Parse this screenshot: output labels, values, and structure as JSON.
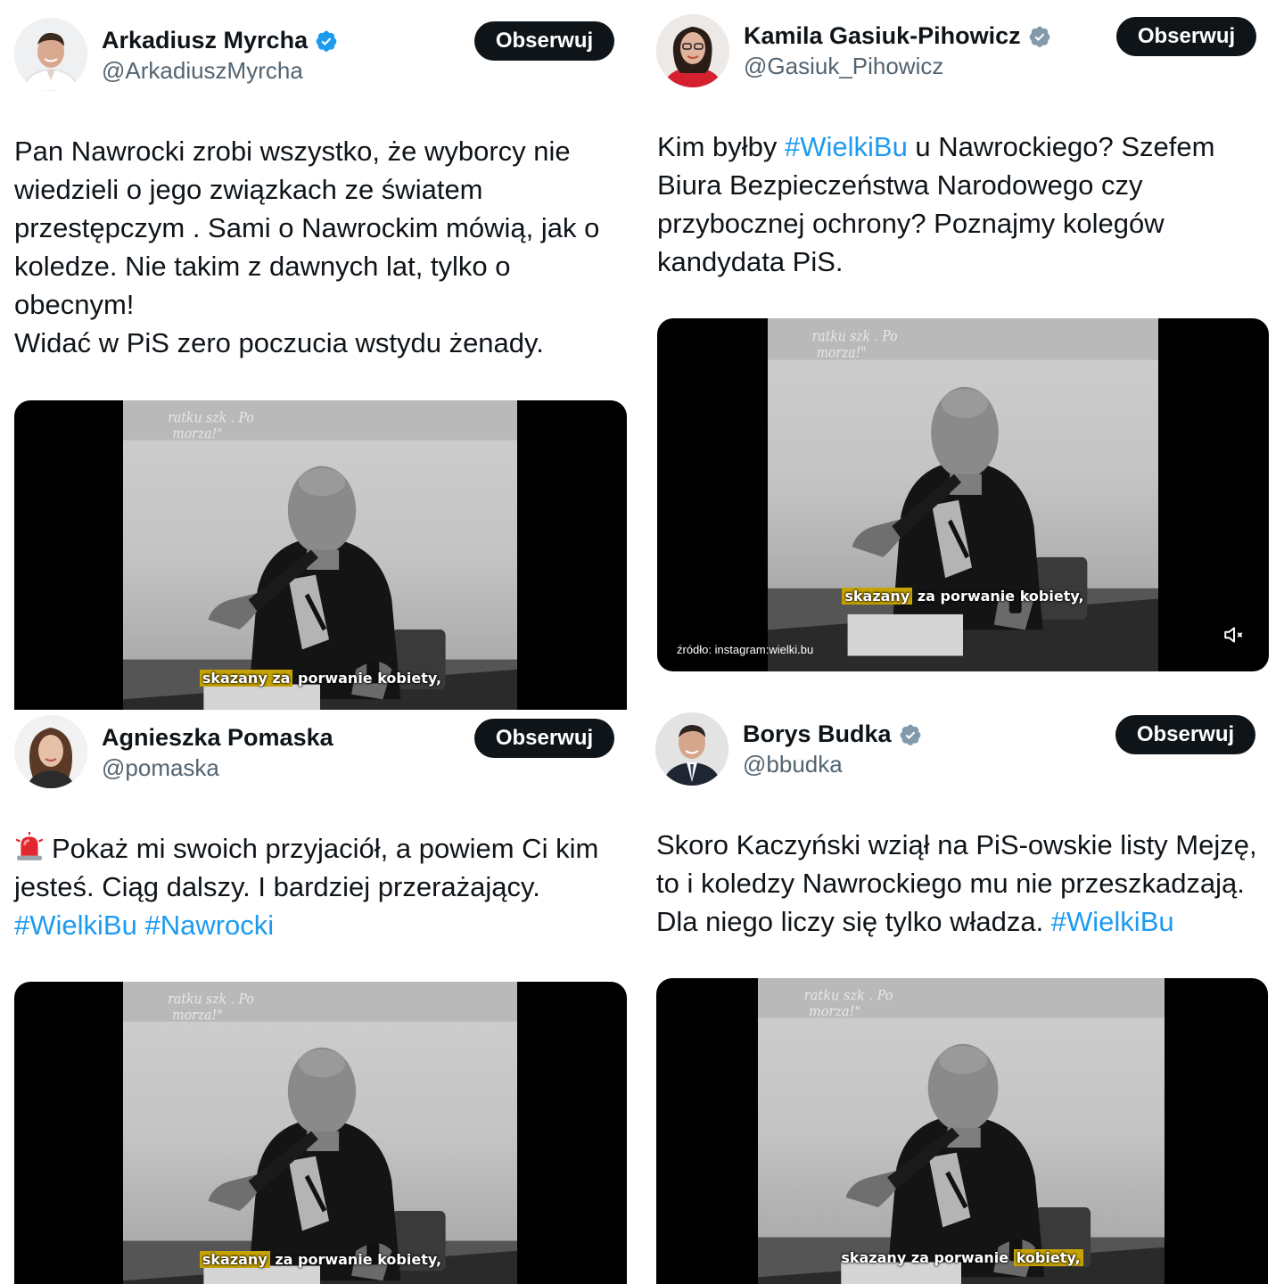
{
  "colors": {
    "link": "#1d9bf0",
    "verified_blue": "#1d9bf0",
    "verified_gray": "#829aab",
    "follow_bg": "#0f1419"
  },
  "tweets": [
    {
      "name": "Arkadiusz Myrcha",
      "handle": "@ArkadiuszMyrcha",
      "follow_label": "Obserwuj",
      "verified": "blue",
      "body_lines": [
        "Pan Nawrocki zrobi wszystko, że wyborcy nie",
        "wiedzieli o jego związkach ze światem",
        "przestępczym . Sami o Nawrockim mówią, jak o",
        "koledze. Nie takim z dawnych lat, tylko o",
        "obecnym!",
        "Widać w PiS zero poczucia wstydu żenady."
      ],
      "video": {
        "caption_highlight": "skazany za",
        "caption_rest": " porwanie kobiety,"
      }
    },
    {
      "name": "Kamila Gasiuk-Pihowicz",
      "handle": "@Gasiuk_Pihowicz",
      "follow_label": "Obserwuj",
      "verified": "gray",
      "body": {
        "l1_pre": "Kim byłby ",
        "l1_tag": "#WielkiBu",
        "l1_post": " u Nawrockiego? Szefem",
        "l2": "Biura Bezpieczeństwa Narodowego czy",
        "l3": "przybocznej ochrony? Poznajmy kolegów",
        "l4": "kandydata PiS."
      },
      "video": {
        "caption_highlight": "skazany",
        "caption_rest": " za porwanie kobiety,",
        "source": "źródło: instagram:wielki.bu",
        "mute_icon": "speaker-muted-icon"
      }
    },
    {
      "name": "Agnieszka Pomaska",
      "handle": "@pomaska",
      "follow_label": "Obserwuj",
      "verified": "none",
      "emoji": "police-light-emoji",
      "body": {
        "l1": "Pokaż mi swoich przyjaciół, a powiem Ci kim",
        "l2": "jesteś. Ciąg dalszy. I bardziej przerażający.",
        "tag1": "#WielkiBu",
        "tag2": "#Nawrocki"
      },
      "video": {
        "caption_highlight": "skazany",
        "caption_rest": " za porwanie kobiety,"
      }
    },
    {
      "name": "Borys Budka",
      "handle": "@bbudka",
      "follow_label": "Obserwuj",
      "verified": "gray",
      "body": {
        "l1": "Skoro Kaczyński wziął na PiS-owskie listy Mejzę,",
        "l2": "to i koledzy Nawrockiego mu nie przeszkadzają.",
        "l3_pre": "Dla niego liczy się tylko władza. ",
        "l3_tag": "#WielkiBu"
      },
      "video": {
        "caption_pre": "skazany",
        "caption_mid": " za porwanie ",
        "caption_highlight": "kobiety,"
      }
    }
  ]
}
